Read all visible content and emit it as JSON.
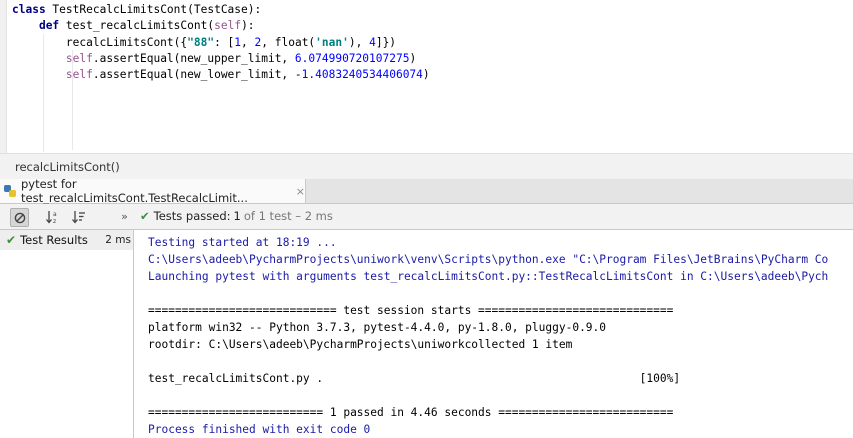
{
  "editor": {
    "code_lines": [
      {
        "parts": [
          {
            "t": "class ",
            "c": "kw"
          },
          {
            "t": "TestRecalcLimitsCont",
            "c": "id"
          },
          {
            "t": "(TestCase):",
            "c": "id"
          }
        ]
      },
      {
        "parts": [
          {
            "t": "    ",
            "c": "id"
          },
          {
            "t": "def ",
            "c": "kw"
          },
          {
            "t": "test_recalcLimitsCont",
            "c": "fn"
          },
          {
            "t": "(",
            "c": "id"
          },
          {
            "t": "self",
            "c": "self"
          },
          {
            "t": "):",
            "c": "id"
          }
        ]
      },
      {
        "parts": [
          {
            "t": "        recalcLimitsCont({",
            "c": "id"
          },
          {
            "t": "\"88\"",
            "c": "str"
          },
          {
            "t": ": [",
            "c": "id"
          },
          {
            "t": "1",
            "c": "num"
          },
          {
            "t": ", ",
            "c": "id"
          },
          {
            "t": "2",
            "c": "num"
          },
          {
            "t": ", float(",
            "c": "id"
          },
          {
            "t": "'nan'",
            "c": "str"
          },
          {
            "t": "), ",
            "c": "id"
          },
          {
            "t": "4",
            "c": "num"
          },
          {
            "t": "]})",
            "c": "id"
          }
        ]
      },
      {
        "parts": [
          {
            "t": "        ",
            "c": "id"
          },
          {
            "t": "self",
            "c": "self"
          },
          {
            "t": ".assertEqual(new_upper_limit, ",
            "c": "id"
          },
          {
            "t": "6.074990720107275",
            "c": "num"
          },
          {
            "t": ")",
            "c": "id"
          }
        ]
      },
      {
        "parts": [
          {
            "t": "        ",
            "c": "id"
          },
          {
            "t": "self",
            "c": "self"
          },
          {
            "t": ".assertEqual(new_lower_limit, -",
            "c": "id"
          },
          {
            "t": "1.4083240534406074",
            "c": "num"
          },
          {
            "t": ")",
            "c": "id"
          }
        ]
      }
    ]
  },
  "breadcrumb": "recalcLimitsCont()",
  "run_tab": {
    "title": "pytest for test_recalcLimitsCont.TestRecalcLimit...",
    "close": "×"
  },
  "toolbar": {
    "status_label": "Tests passed:",
    "status_count": "1",
    "status_meta": "of 1 test – 2 ms",
    "expand_icon": "»"
  },
  "tree": {
    "label": "Test Results",
    "duration": "2 ms"
  },
  "console": {
    "lines": [
      {
        "text": "Testing started at 18:19 ...",
        "color": "blue"
      },
      {
        "text": "C:\\Users\\adeeb\\PycharmProjects\\uniwork\\venv\\Scripts\\python.exe \"C:\\Program Files\\JetBrains\\PyCharm Co",
        "color": "blue"
      },
      {
        "text": "Launching pytest with arguments test_recalcLimitsCont.py::TestRecalcLimitsCont in C:\\Users\\adeeb\\Pych",
        "color": "blue"
      },
      {
        "text": "",
        "color": "black"
      },
      {
        "text": "============================ test session starts =============================",
        "color": "black"
      },
      {
        "text": "platform win32 -- Python 3.7.3, pytest-4.4.0, py-1.8.0, pluggy-0.9.0",
        "color": "black"
      },
      {
        "text": "rootdir: C:\\Users\\adeeb\\PycharmProjects\\uniworkcollected 1 item",
        "color": "black"
      },
      {
        "text": "",
        "color": "black"
      },
      {
        "text": "test_recalcLimitsCont.py .                                               [100%]",
        "color": "black"
      },
      {
        "text": "",
        "color": "black"
      },
      {
        "text": "========================== 1 passed in 4.46 seconds ==========================",
        "color": "black"
      },
      {
        "text": "Process finished with exit code 0",
        "color": "blue"
      }
    ]
  }
}
